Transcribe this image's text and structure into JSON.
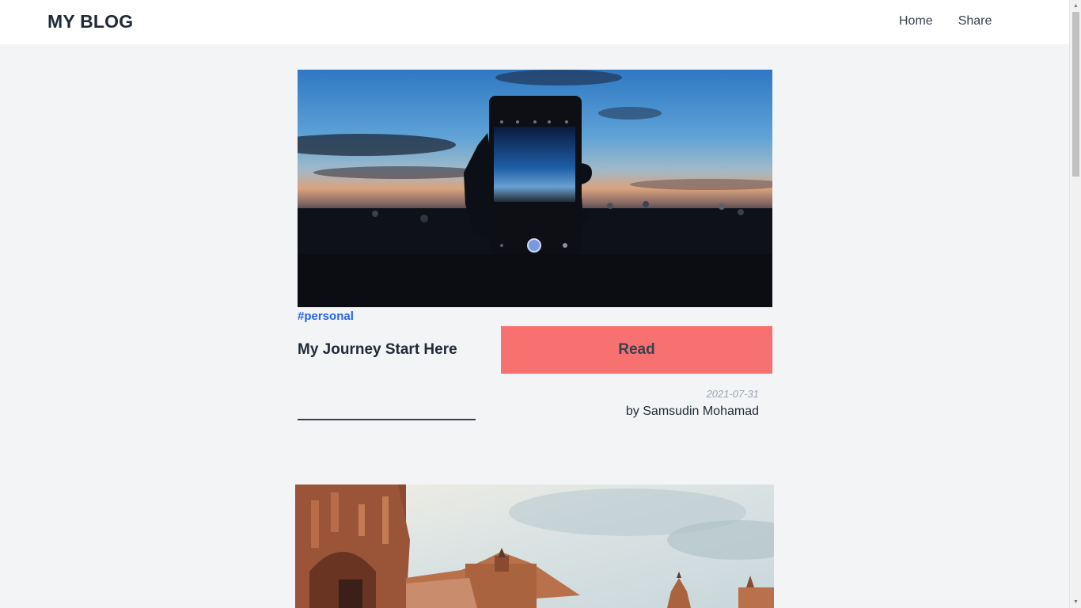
{
  "header": {
    "brand": "MY BLOG",
    "nav": [
      "Home",
      "Share"
    ]
  },
  "posts": [
    {
      "image": "phone-sunset-photo",
      "tag": "#personal",
      "title": "My Journey Start Here",
      "read_label": "Read",
      "date": "2021-07-31",
      "author": "by Samsudin Mohamad"
    },
    {
      "image": "palace-building-photo"
    }
  ],
  "colors": {
    "accent_button": "#f87171",
    "tag": "#2563eb",
    "background": "#f3f4f6"
  }
}
